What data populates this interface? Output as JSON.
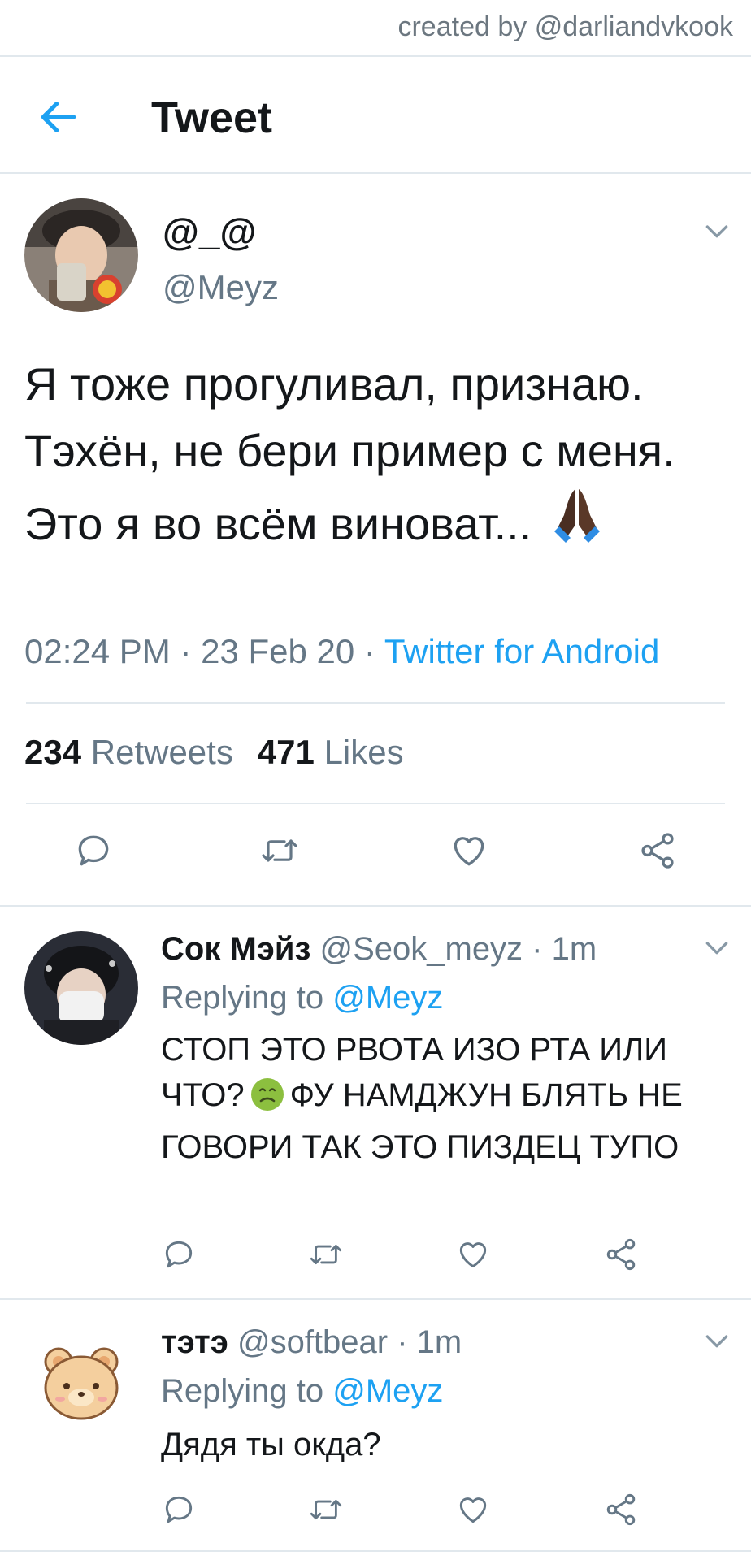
{
  "watermark": "created by @darliandvkook",
  "header": {
    "title": "Tweet",
    "back_icon": "arrow-left-icon"
  },
  "colors": {
    "accent": "#1da1f2",
    "secondary_text": "#657786",
    "divider": "#e1e8ed"
  },
  "tweet": {
    "display_name": "@_@",
    "handle": "@Meyz",
    "text": "Я тоже прогуливал, признаю. Тэхён, не бери пример с меня. Это я во всём виноват...",
    "emoji_icon": "folded-hands-icon",
    "time": "02:24 PM",
    "sep": " · ",
    "date": "23 Feb 20",
    "source": "Twitter for Android",
    "retweets_count": "234",
    "retweets_label": "Retweets",
    "likes_count": "471",
    "likes_label": "Likes"
  },
  "replies": [
    {
      "display_name": "Сок Мэйз",
      "handle": "@Seok_meyz",
      "time": "1m",
      "replying_label": "Replying to",
      "replying_to": "@Meyz",
      "text_part1": "СТОП ЭТО РВОТА ИЗО РТА ИЛИ ЧТО?",
      "emoji_icon": "nauseated-face-icon",
      "text_part2": "ФУ НАМДЖУН БЛЯТЬ НЕ ГОВОРИ ТАК ЭТО ПИЗДЕЦ ТУПО"
    },
    {
      "display_name": "тэтэ",
      "handle": "@softbear",
      "time": "1m",
      "replying_label": "Replying to",
      "replying_to": "@Meyz",
      "text": "Дядя ты окда?"
    }
  ]
}
